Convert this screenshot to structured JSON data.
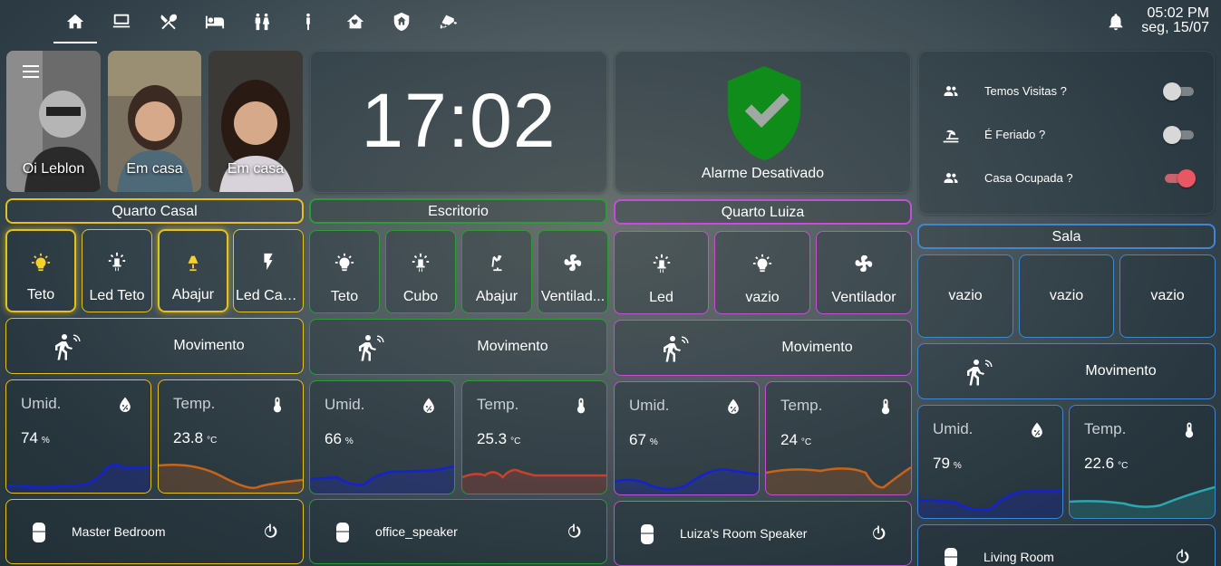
{
  "topbar": {
    "tabs": [
      {
        "icon": "home-icon"
      },
      {
        "icon": "desktop-icon"
      },
      {
        "icon": "silverware-icon"
      },
      {
        "icon": "bed-icon"
      },
      {
        "icon": "human-male-female-icon"
      },
      {
        "icon": "human-child-icon"
      },
      {
        "icon": "home-heart-icon"
      },
      {
        "icon": "shield-home-icon"
      },
      {
        "icon": "cctv-icon"
      }
    ],
    "time": "05:02 PM",
    "date": "seg, 15/07"
  },
  "people": [
    {
      "name": "Oi Leblon"
    },
    {
      "name": "Em casa"
    },
    {
      "name": "Em casa"
    }
  ],
  "clock": {
    "time": "17:02"
  },
  "alarm": {
    "label": "Alarme Desativado",
    "color": "#0f8c1a"
  },
  "toggles": [
    {
      "label": "Temos Visitas ?",
      "icon": "account-group-icon",
      "state": "off"
    },
    {
      "label": "É Feriado ?",
      "icon": "beach-icon",
      "state": "off"
    },
    {
      "label": "Casa Ocupada ?",
      "icon": "account-group-icon",
      "state": "on"
    }
  ],
  "rooms": [
    {
      "title": "Quarto Casal",
      "accent": "#e3c11f",
      "buttons": [
        {
          "label": "Teto",
          "icon": "lightbulb-on-icon",
          "on": true
        },
        {
          "label": "Led Teto",
          "icon": "led-bulb-icon",
          "on": false
        },
        {
          "label": "Abajur",
          "icon": "lamp-icon",
          "on": true
        },
        {
          "label": "Led Cama",
          "icon": "flash-icon",
          "on": false
        }
      ],
      "motion": "Movimento",
      "humidity": {
        "label": "Umid.",
        "value": "74",
        "unit": "%",
        "color": "#1522d0"
      },
      "temperature": {
        "label": "Temp.",
        "value": "23.8",
        "unit": "°C",
        "color": "#c8641a"
      },
      "speaker": "Master Bedroom"
    },
    {
      "title": "Escritorio",
      "accent": "#2f9a3a",
      "buttons": [
        {
          "label": "Teto",
          "icon": "lightbulb-on-icon",
          "on": false
        },
        {
          "label": "Cubo",
          "icon": "led-bulb-icon",
          "on": false
        },
        {
          "label": "Abajur",
          "icon": "desk-lamp-icon",
          "on": false
        },
        {
          "label": "Ventilad...",
          "icon": "fan-icon",
          "on": false
        }
      ],
      "motion": "Movimento",
      "humidity": {
        "label": "Umid.",
        "value": "66",
        "unit": "%",
        "color": "#1522d0"
      },
      "temperature": {
        "label": "Temp.",
        "value": "25.3",
        "unit": "°C",
        "color": "#c8412a"
      },
      "speaker": "office_speaker"
    },
    {
      "title": "Quarto Luiza",
      "accent": "#c34fd6",
      "buttons": [
        {
          "label": "Led",
          "icon": "led-bulb-icon",
          "on": false
        },
        {
          "label": "vazio",
          "icon": "lightbulb-on-icon",
          "on": false
        },
        {
          "label": "Ventilador",
          "icon": "fan-icon",
          "on": false
        }
      ],
      "motion": "Movimento",
      "humidity": {
        "label": "Umid.",
        "value": "67",
        "unit": "%",
        "color": "#1522d0"
      },
      "temperature": {
        "label": "Temp.",
        "value": "24",
        "unit": "°C",
        "color": "#c8641a"
      },
      "speaker": "Luiza's Room Speaker"
    },
    {
      "title": "Sala",
      "accent": "#3f86d6",
      "buttons": [
        {
          "label": "vazio",
          "on": false
        },
        {
          "label": "vazio",
          "on": false
        },
        {
          "label": "vazio",
          "on": false
        }
      ],
      "motion": "Movimento",
      "humidity": {
        "label": "Umid.",
        "value": "79",
        "unit": "%",
        "color": "#1522d0"
      },
      "temperature": {
        "label": "Temp.",
        "value": "22.6",
        "unit": "°C",
        "color": "#2aa8b0"
      },
      "speaker": "Living Room"
    }
  ]
}
